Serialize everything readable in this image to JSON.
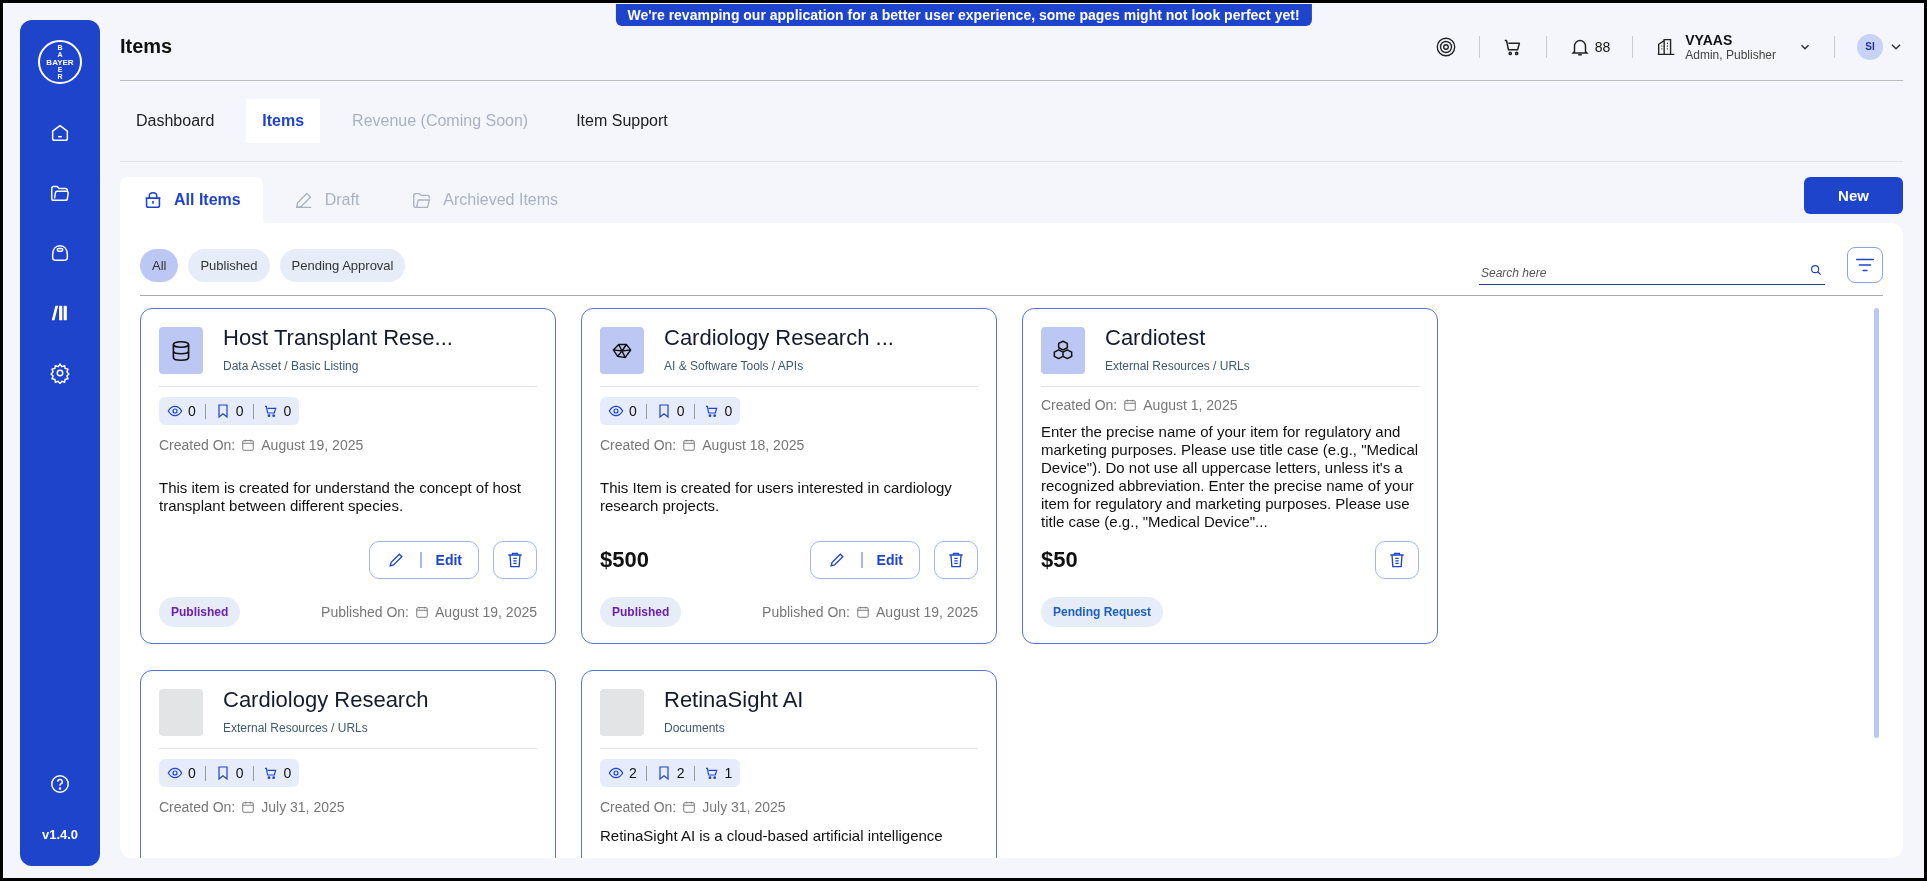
{
  "banner": "We're revamping our application for a better user experience, some pages might not look perfect yet!",
  "sidebar": {
    "logo": {
      "horizontal": "BAYER",
      "vertical_top": "BA",
      "vertical_bottom": "ER"
    },
    "version": "v1.4.0"
  },
  "header": {
    "title": "Items",
    "notifications": "88",
    "org": {
      "name": "VYAAS",
      "role": "Admin, Publisher"
    },
    "avatar": "SI"
  },
  "nav_tabs": [
    {
      "label": "Dashboard",
      "selected": false,
      "disabled": false
    },
    {
      "label": "Items",
      "selected": true,
      "disabled": false
    },
    {
      "label": "Revenue (Coming Soon)",
      "selected": false,
      "disabled": true
    },
    {
      "label": "Item Support",
      "selected": false,
      "disabled": false
    }
  ],
  "item_tabs": [
    {
      "label": "All Items",
      "selected": true
    },
    {
      "label": "Draft",
      "selected": false
    },
    {
      "label": "Archieved Items",
      "selected": false
    }
  ],
  "new_button": "New",
  "filters": [
    {
      "label": "All",
      "selected": true
    },
    {
      "label": "Published",
      "selected": false
    },
    {
      "label": "Pending Approval",
      "selected": false
    }
  ],
  "search": {
    "placeholder": "Search here"
  },
  "cards": [
    {
      "title": "Host Transplant Rese...",
      "category": "Data Asset / Basic Listing",
      "views": "0",
      "saves": "0",
      "carts": "0",
      "created_label": "Created On:",
      "created_on": "August 19, 2025",
      "description": "This item is created for understand the concept of host transplant between different species.",
      "editable": true,
      "edit_label": "Edit",
      "status": {
        "label": "Published",
        "kind": "published"
      },
      "published_label": "Published On:",
      "published_on": "August 19, 2025"
    },
    {
      "title": "Cardiology Research ...",
      "category": "AI & Software Tools / APIs",
      "views": "0",
      "saves": "0",
      "carts": "0",
      "created_label": "Created On:",
      "created_on": "August 18, 2025",
      "description": "This Item is created for users interested in cardiology research projects.",
      "price": "$500",
      "editable": true,
      "edit_label": "Edit",
      "status": {
        "label": "Published",
        "kind": "published"
      },
      "published_label": "Published On:",
      "published_on": "August 19, 2025"
    },
    {
      "title": "Cardiotest",
      "category": "External Resources / URLs",
      "created_label": "Created On:",
      "created_on": "August 1, 2025",
      "description": "Enter the precise name of your item for regulatory and marketing purposes. Please use title case (e.g., \"Medical Device\"). Do not use all uppercase letters, unless it's a recognized abbreviation. Enter the precise name of your item for regulatory and marketing purposes. Please use title case (e.g., \"Medical Device\"...",
      "price": "$50",
      "editable": false,
      "status": {
        "label": "Pending Request",
        "kind": "pending"
      }
    },
    {
      "title": "Cardiology Research",
      "category": "External Resources / URLs",
      "views": "0",
      "saves": "0",
      "carts": "0",
      "created_label": "Created On:",
      "created_on": "July 31, 2025"
    },
    {
      "title": "RetinaSight AI",
      "category": "Documents",
      "views": "2",
      "saves": "2",
      "carts": "1",
      "created_label": "Created On:",
      "created_on": "July 31, 2025",
      "description": "RetinaSight AI is a cloud-based artificial intelligence"
    }
  ]
}
